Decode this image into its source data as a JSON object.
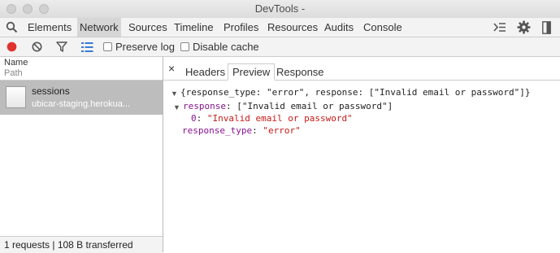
{
  "window": {
    "title": "DevTools -"
  },
  "toolbar": {
    "tabs": [
      {
        "label": "Elements"
      },
      {
        "label": "Network"
      },
      {
        "label": "Sources"
      },
      {
        "label": "Timeline"
      },
      {
        "label": "Profiles"
      },
      {
        "label": "Resources"
      },
      {
        "label": "Audits"
      },
      {
        "label": "Console"
      }
    ],
    "selected_tab": "Network"
  },
  "subbar": {
    "preserve_log_label": "Preserve log",
    "disable_cache_label": "Disable cache",
    "record_color": "#e0332d"
  },
  "requests": {
    "header_name": "Name",
    "header_path": "Path",
    "items": [
      {
        "name": "sessions",
        "path": "ubicar-staging.herokua..."
      }
    ],
    "status": "1 requests | 108 B transferred"
  },
  "detail": {
    "close": "×",
    "tabs": [
      {
        "label": "Headers"
      },
      {
        "label": "Preview"
      },
      {
        "label": "Response"
      }
    ],
    "selected_tab": "Preview",
    "preview": {
      "summary": "{response_type: \"error\", response: [\"Invalid email or password\"]}",
      "response_key": "response",
      "response_value": ": [\"Invalid email or password\"]",
      "index_key": "0",
      "index_value": "\"Invalid email or password\"",
      "type_key": "response_type",
      "type_value": "\"error\""
    }
  }
}
